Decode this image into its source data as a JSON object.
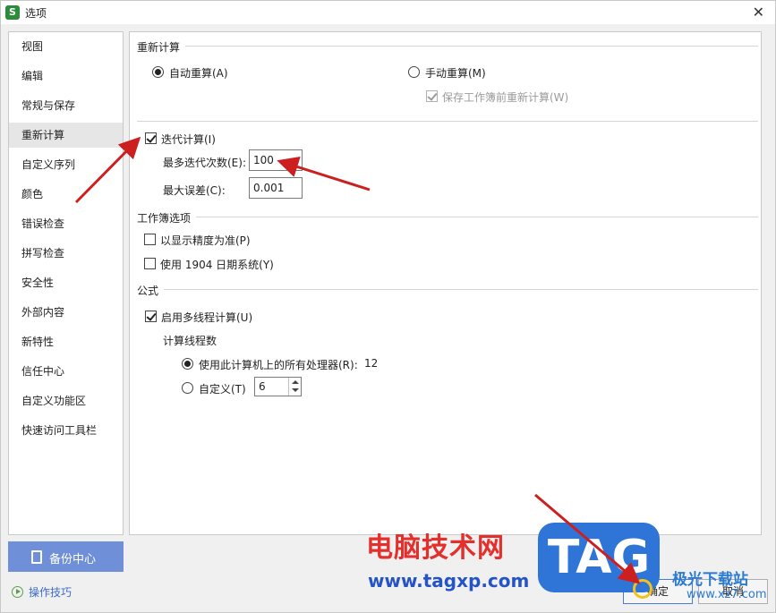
{
  "window": {
    "title": "选项",
    "app_icon_letter": "S"
  },
  "sidebar": {
    "items": [
      {
        "label": "视图"
      },
      {
        "label": "编辑"
      },
      {
        "label": "常规与保存"
      },
      {
        "label": "重新计算",
        "active": true
      },
      {
        "label": "自定义序列"
      },
      {
        "label": "颜色"
      },
      {
        "label": "错误检查"
      },
      {
        "label": "拼写检查"
      },
      {
        "label": "安全性"
      },
      {
        "label": "外部内容"
      },
      {
        "label": "新特性"
      },
      {
        "label": "信任中心"
      },
      {
        "label": "自定义功能区"
      },
      {
        "label": "快速访问工具栏"
      }
    ],
    "backup_label": "备份中心",
    "tips_label": "操作技巧"
  },
  "recalc": {
    "section_title": "重新计算",
    "auto_label": "自动重算(A)",
    "auto_selected": true,
    "manual_label": "手动重算(M)",
    "manual_selected": false,
    "save_recalc_label": "保存工作簿前重新计算(W)",
    "save_recalc_checked": true
  },
  "iteration": {
    "enable_label": "迭代计算(I)",
    "enable_checked": true,
    "max_iter_label": "最多迭代次数(E):",
    "max_iter_value": "100",
    "max_error_label": "最大误差(C):",
    "max_error_value": "0.001"
  },
  "workbook": {
    "section_title": "工作簿选项",
    "precision_label": "以显示精度为准(P)",
    "precision_checked": false,
    "date1904_label": "使用 1904 日期系统(Y)",
    "date1904_checked": false
  },
  "formula": {
    "section_title": "公式",
    "multithread_label": "启用多线程计算(U)",
    "multithread_checked": true,
    "threads_title": "计算线程数",
    "all_processors_label": "使用此计算机上的所有处理器(R):",
    "all_processors_count": "12",
    "all_processors_selected": true,
    "custom_label": "自定义(T)",
    "custom_selected": false,
    "custom_value": "6"
  },
  "buttons": {
    "ok_label": "确定",
    "cancel_label": "取消"
  },
  "watermark": {
    "cn_text": "电脑技术网",
    "url_text": "www.tagxp.com",
    "tag_text": "TAG",
    "site2_cn": "极光下载站",
    "site2_url": "www.xz7.com"
  },
  "colors": {
    "accent": "#6f90d8",
    "annotation_arrow": "#cc2020",
    "link": "#3b6bc9"
  }
}
